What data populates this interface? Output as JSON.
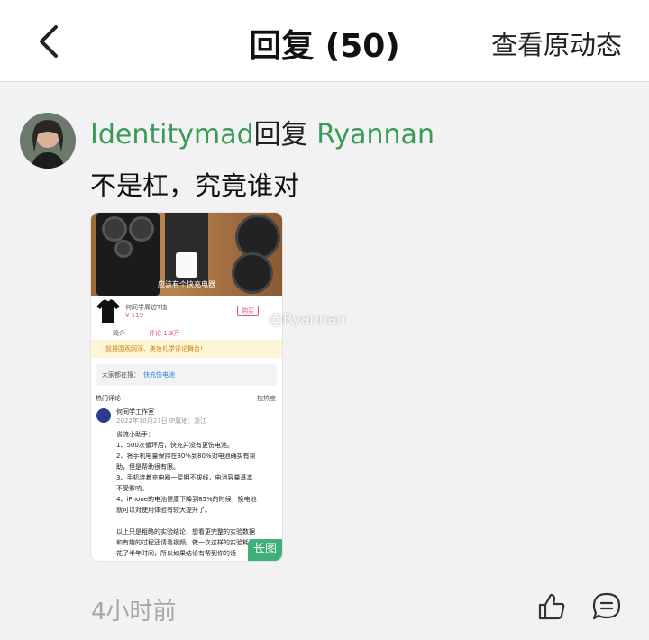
{
  "header": {
    "title": "回复 (50)",
    "view_original": "查看原动态"
  },
  "reply": {
    "username": "Identitymad",
    "reply_word": "回复",
    "target": "Ryannan",
    "text": "不是杠，究竟谁对",
    "time": "4小时前",
    "watermark": "@Ryannan",
    "image_badge": "长图"
  },
  "screenshot": {
    "hero_caption": "应该有个快充电器",
    "product_name": "何同学周边T恤",
    "price": "¥ 119",
    "buy": "购买",
    "tab_intro": "简介",
    "tab_comments": "评论 1.8万",
    "notice": "前排围观网深、美妆礼学评论舞台!",
    "search_hint": "大家都在搜：",
    "search_term": "快充伤电池",
    "hot_comments": "热门评论",
    "sort": "按热度",
    "commenter": "何同学工作室",
    "comment_date": "2022年10月27日 IP属地：浙江",
    "comment_lines": [
      "省流小助手：",
      "1、500次循环后，快充并没有更伤电池。",
      "2、将手机电量保持在30%到80%对电池确实有帮",
      "助，但是帮助很有限。",
      "3、手机连着充电器一星期不拔线，电池容量基本",
      "不受影响。",
      "4、iPhone的电池健康下降到85%的时候，换电池",
      "就可以对使用体验有较大提升了。",
      "",
      "以上只是粗略的实验结论，想看更完整的实验数据",
      "和有趣的过程还请看视频。做一次这样的实验耗时",
      "花了半年时间，所以如果结论有帮到你的话"
    ]
  },
  "colors": {
    "accent_green": "#3a9b57",
    "background": "#f2f2f4"
  }
}
